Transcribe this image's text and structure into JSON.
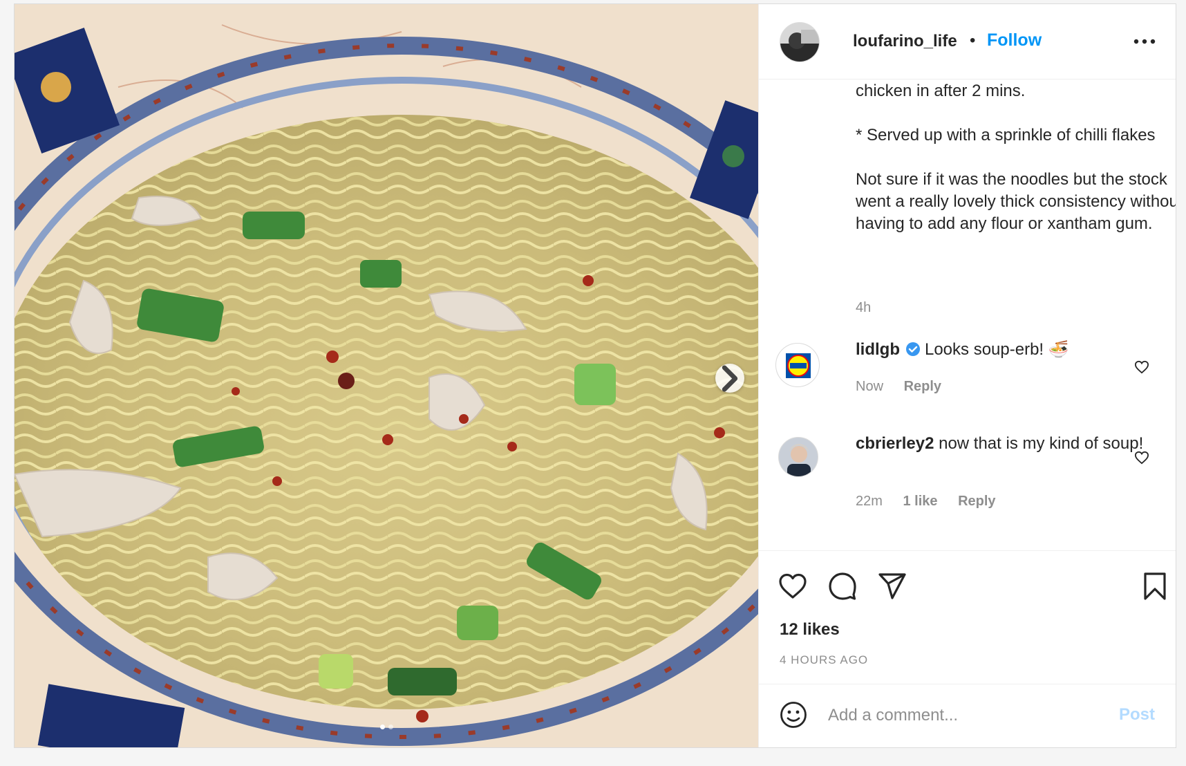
{
  "post": {
    "username": "loufarino_life",
    "separator": "•",
    "follow_label": "Follow",
    "caption": "chicken in after 2 mins.\n\n* Served up with a sprinkle of chilli flakes\n\nNot sure if it was the noodles but the stock went a really lovely thick consistency without having to add any flour or xantham gum.",
    "caption_time": "4h",
    "likes": "12 likes",
    "time_ago": "4 HOURS AGO"
  },
  "comments": [
    {
      "username": "lidlgb",
      "text": "Looks soup-erb! 🍜",
      "time": "Now",
      "likes": "",
      "reply_label": "Reply"
    },
    {
      "username": "cbrierley2",
      "text": "now that is my kind of soup!",
      "time": "22m",
      "likes": "1 like",
      "reply_label": "Reply"
    }
  ],
  "composer": {
    "placeholder": "Add a comment...",
    "post_label": "Post"
  },
  "carousel": {
    "current_index": 1,
    "total": 2
  },
  "colors": {
    "accent": "#0095f6",
    "post_disabled": "#b3dbff",
    "secondary_text": "#8e8e8e"
  }
}
